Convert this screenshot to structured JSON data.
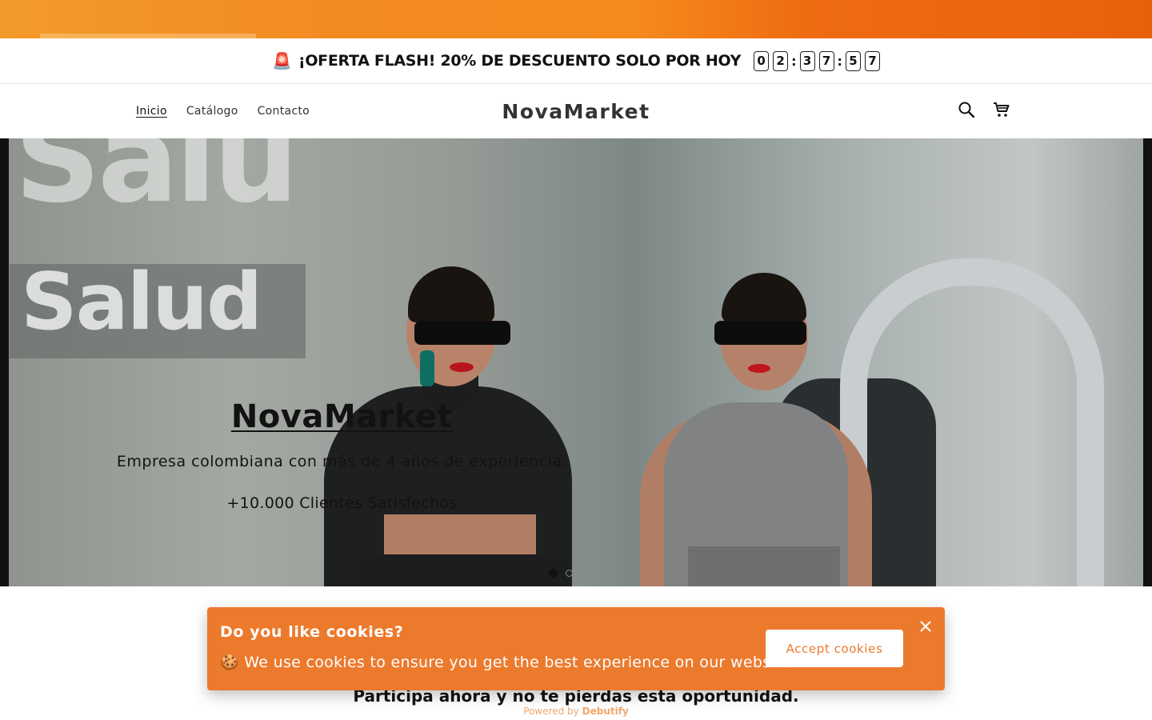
{
  "flash_bar": {
    "siren_icon": "🚨",
    "message": "¡OFERTA FLASH! 20% DE DESCUENTO SOLO POR HOY",
    "countdown": [
      "0",
      "2",
      ":",
      "3",
      "7",
      ":",
      "5",
      "7"
    ]
  },
  "header": {
    "nav": [
      "Inicio",
      "Catálogo",
      "Contacto"
    ],
    "active_nav": "Inicio",
    "logo": "NovaMarket",
    "icons": [
      "search-icon",
      "cart-icon"
    ]
  },
  "hero": {
    "title": "NovaMarket",
    "subtitle": "Empresa colombiana con más de 4 años de experiencia.",
    "tagline": "+10.000 Clientes Satisfechos",
    "wall_text_top": "Salu",
    "wall_text": "Salud",
    "slide_count": 3,
    "active_slide": 1
  },
  "cta_text": "Participa ahora y no te pierdas esta oportunidad.",
  "powered_by": {
    "prefix": "Powered by",
    "brand": "Debutify"
  },
  "cookie_banner": {
    "title": "Do you like cookies?",
    "text": "🍪 We use cookies to ensure you get the best experience on our website.",
    "accept_label": "Accept cookies",
    "accent_color": "#ec7a2d"
  },
  "colors": {
    "banner_orange": "#f28a22",
    "text_dark": "#121212"
  }
}
